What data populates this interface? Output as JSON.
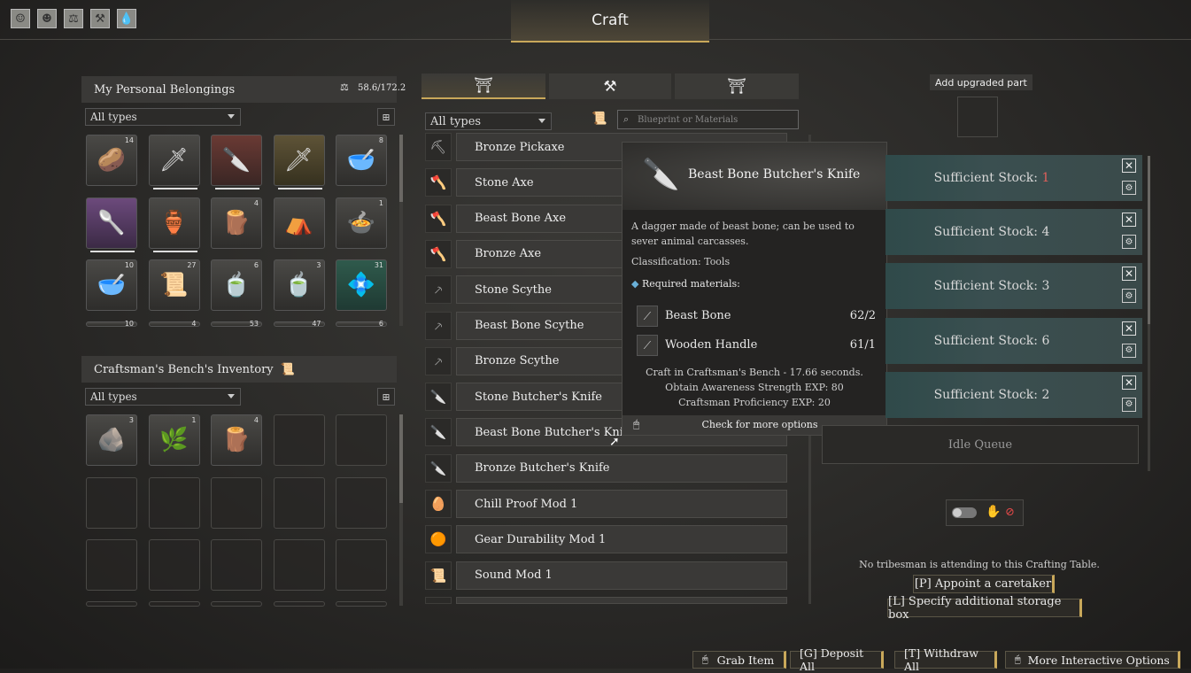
{
  "header": {
    "title": "Craft",
    "top_icons": [
      "profile-icon",
      "portrait-icon",
      "weight-icon",
      "tool-icon",
      "water-drop-icon"
    ]
  },
  "personal": {
    "title": "My Personal Belongings",
    "weight": "58.6/172.2",
    "filter": "All types",
    "slots": [
      {
        "count": "14",
        "icon": "🥔",
        "style": ""
      },
      {
        "count": "",
        "icon": "🗡",
        "style": "",
        "durability": true
      },
      {
        "count": "",
        "icon": "🔪",
        "style": "red",
        "durability": true
      },
      {
        "count": "",
        "icon": "🗡",
        "style": "gold",
        "durability": true
      },
      {
        "count": "8",
        "icon": "🥣",
        "style": ""
      },
      {
        "count": "",
        "icon": "🥄",
        "style": "purple",
        "durability": true
      },
      {
        "count": "",
        "icon": "🏺",
        "style": "",
        "durability": true
      },
      {
        "count": "4",
        "icon": "🪵",
        "style": ""
      },
      {
        "count": "",
        "icon": "⛺",
        "style": ""
      },
      {
        "count": "1",
        "icon": "🍲",
        "style": ""
      },
      {
        "count": "10",
        "icon": "🥣",
        "style": ""
      },
      {
        "count": "27",
        "icon": "📜",
        "style": ""
      },
      {
        "count": "6",
        "icon": "🍵",
        "style": ""
      },
      {
        "count": "3",
        "icon": "🍵",
        "style": ""
      },
      {
        "count": "31",
        "icon": "💠",
        "style": "teal"
      }
    ],
    "partial_row_counts": [
      "10",
      "4",
      "53",
      "47",
      "6"
    ]
  },
  "bench": {
    "title": "Craftsman's Bench's Inventory",
    "filter": "All types",
    "slots": [
      {
        "count": "3",
        "icon": "🪨"
      },
      {
        "count": "1",
        "icon": "🌿"
      },
      {
        "count": "4",
        "icon": "🪵"
      }
    ]
  },
  "recipes": {
    "filter": "All types",
    "search_placeholder": "Blueprint or Materials",
    "tab_icons": [
      "bench-tab-icon",
      "anvil-tab-icon",
      "table-tab-icon"
    ],
    "items": [
      {
        "name": "Bronze Pickaxe",
        "icon": "⛏"
      },
      {
        "name": "Stone Axe",
        "icon": "🪓"
      },
      {
        "name": "Beast Bone Axe",
        "icon": "🪓"
      },
      {
        "name": "Bronze Axe",
        "icon": "🪓"
      },
      {
        "name": "Stone Scythe",
        "icon": "⸕"
      },
      {
        "name": "Beast Bone Scythe",
        "icon": "⸕"
      },
      {
        "name": "Bronze Scythe",
        "icon": "⸕"
      },
      {
        "name": "Stone Butcher's Knife",
        "icon": "🔪"
      },
      {
        "name": "Beast Bone Butcher's Knife",
        "icon": "🔪"
      },
      {
        "name": "Bronze Butcher's Knife",
        "icon": "🔪"
      },
      {
        "name": "Chill Proof Mod 1",
        "icon": "🥚"
      },
      {
        "name": "Gear Durability Mod 1",
        "icon": "🟠"
      },
      {
        "name": "Sound Mod 1",
        "icon": "📜"
      }
    ]
  },
  "tooltip": {
    "title": "Beast Bone Butcher's Knife",
    "description": "A dagger made of beast bone; can be used to sever animal carcasses.",
    "classification": "Classification: Tools",
    "required_label": "Required materials:",
    "materials": [
      {
        "name": "Beast Bone",
        "qty": "62/2"
      },
      {
        "name": "Wooden Handle",
        "qty": "61/1"
      }
    ],
    "craft_time": "Craft in Craftsman's Bench - 17.66 seconds.",
    "exp1": "Obtain Awareness Strength EXP: 80",
    "exp2": "Craftsman Proficiency EXP: 20",
    "more": "Check for more options"
  },
  "queue": {
    "add_part": "Add upgraded part",
    "rows": [
      {
        "label": "Sufficient Stock:",
        "num": "1",
        "highlight": true
      },
      {
        "label": "Sufficient Stock:",
        "num": "4"
      },
      {
        "label": "Sufficient Stock:",
        "num": "3"
      },
      {
        "label": "Sufficient Stock:",
        "num": "6"
      },
      {
        "label": "Sufficient Stock:",
        "num": "2"
      }
    ],
    "idle": "Idle Queue",
    "no_tribesman": "No tribesman is attending to this Crafting Table.",
    "appoint": "[P]  Appoint a caretaker",
    "storage": "[L]  Specify additional storage box"
  },
  "bottom": {
    "grab": "Grab Item",
    "deposit": "[G]  Deposit All",
    "withdraw": "[T]  Withdraw All",
    "more": "More Interactive Options"
  },
  "colors": {
    "accent": "#c9a85a",
    "stock_red": "#e0605a",
    "queue_teal": "#34504f"
  }
}
